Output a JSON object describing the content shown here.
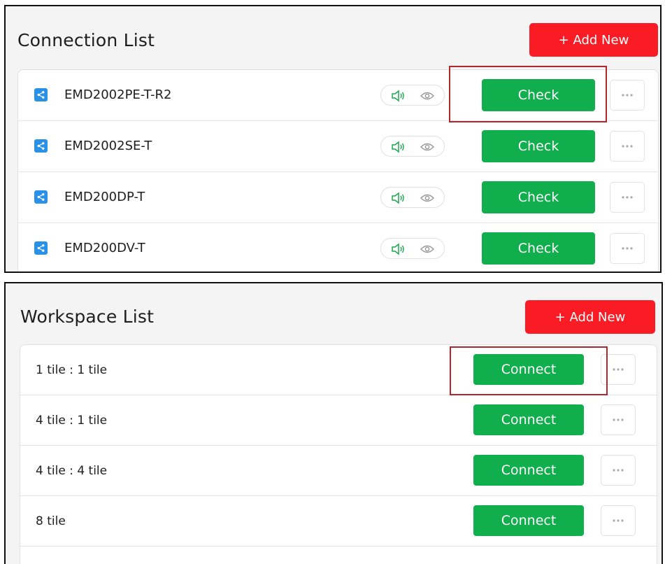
{
  "connection_list": {
    "title": "Connection List",
    "add_button": "+ Add New",
    "check_label": "Check",
    "items": [
      {
        "name": "EMD2002PE-T-R2"
      },
      {
        "name": "EMD2002SE-T"
      },
      {
        "name": "EMD200DP-T"
      },
      {
        "name": "EMD200DV-T"
      }
    ]
  },
  "workspace_list": {
    "title": "Workspace List",
    "add_button": "+ Add New",
    "connect_label": "Connect",
    "items": [
      {
        "name": "1 tile : 1 tile"
      },
      {
        "name": "4 tile : 1 tile"
      },
      {
        "name": "4 tile : 4 tile"
      },
      {
        "name": "8 tile"
      }
    ]
  },
  "colors": {
    "add_button": "#fa1c24",
    "action_button": "#10ae4c",
    "share_icon": "#2a91e8",
    "highlight_box": "#b3262b",
    "status_icon_speaker": "#19a84a",
    "status_icon_eye": "#9a9a9a"
  },
  "icons": {
    "connection_item": "share-icon",
    "status_audio": "speaker-icon",
    "status_view": "eye-icon",
    "more": "more-icon"
  }
}
